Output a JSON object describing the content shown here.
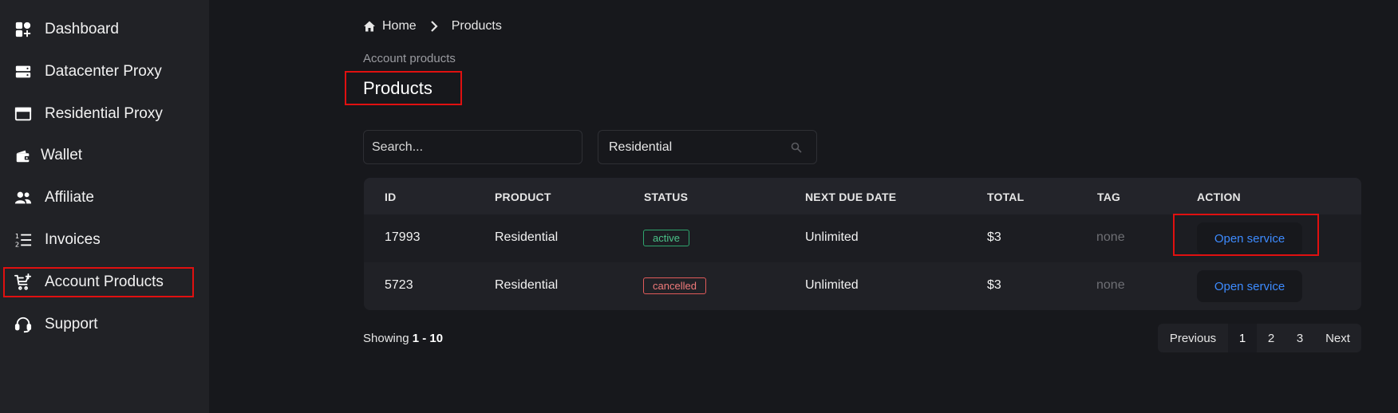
{
  "sidebar": {
    "items": [
      {
        "label": "Dashboard"
      },
      {
        "label": "Datacenter Proxy"
      },
      {
        "label": "Residential Proxy"
      },
      {
        "label": "Wallet"
      },
      {
        "label": "Affiliate"
      },
      {
        "label": "Invoices"
      },
      {
        "label": "Account Products"
      },
      {
        "label": "Support"
      }
    ]
  },
  "breadcrumb": {
    "home": "Home",
    "current": "Products"
  },
  "header": {
    "subtitle": "Account products",
    "title": "Products"
  },
  "filters": {
    "search_placeholder": "Search...",
    "type_value": "Residential"
  },
  "table": {
    "columns": [
      "ID",
      "PRODUCT",
      "STATUS",
      "NEXT DUE DATE",
      "TOTAL",
      "TAG",
      "ACTION"
    ],
    "rows": [
      {
        "id": "17993",
        "product": "Residential",
        "status": "active",
        "due": "Unlimited",
        "total": "$3",
        "tag": "none",
        "action": "Open service"
      },
      {
        "id": "5723",
        "product": "Residential",
        "status": "cancelled",
        "due": "Unlimited",
        "total": "$3",
        "tag": "none",
        "action": "Open service"
      }
    ]
  },
  "footer": {
    "showing_label": "Showing",
    "showing_range": "1 - 10",
    "pagination": {
      "previous": "Previous",
      "pages": [
        "1",
        "2",
        "3"
      ],
      "next": "Next"
    }
  },
  "colors": {
    "accent": "#3d8bff",
    "highlight": "#e01010",
    "active": "#4cc38a",
    "cancelled": "#f07a7a"
  }
}
